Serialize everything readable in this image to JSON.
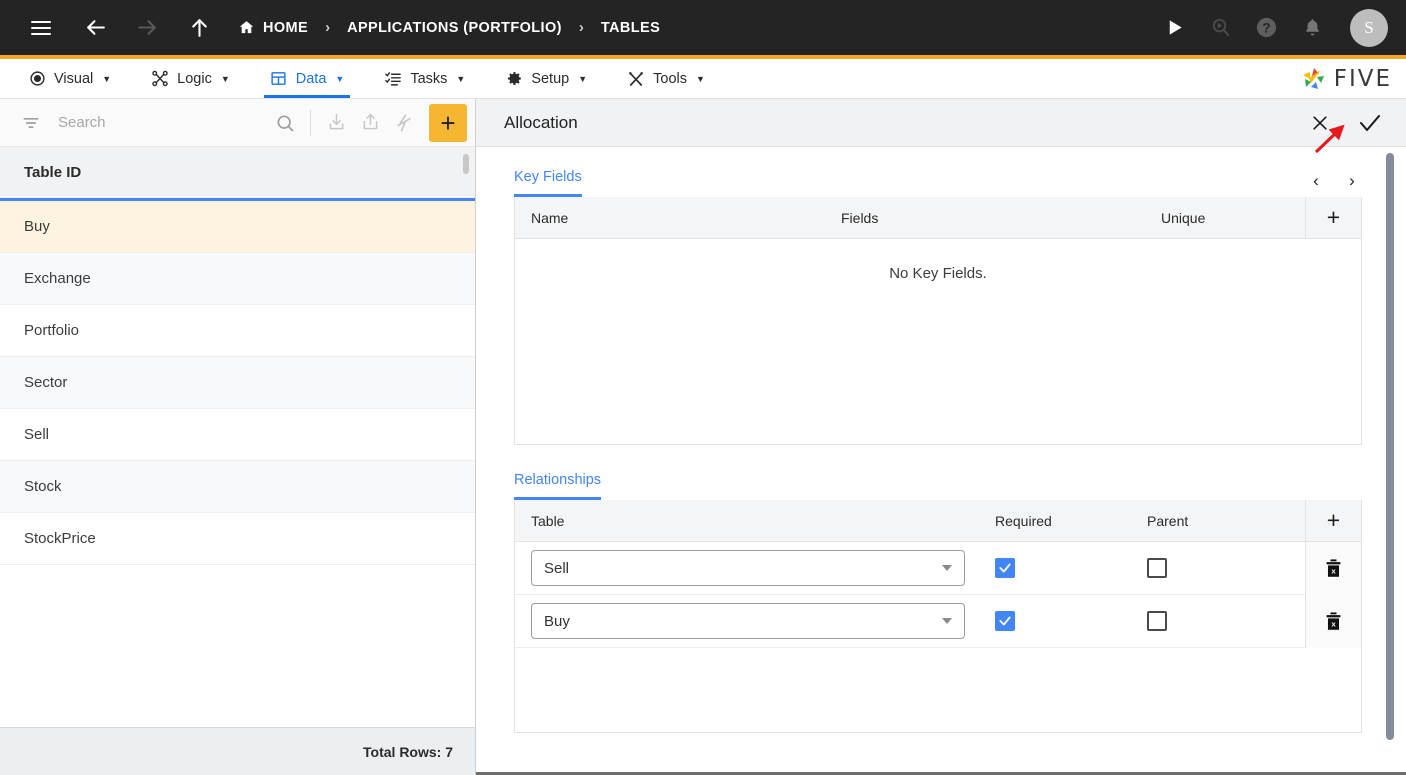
{
  "topbar": {
    "menu_icon": "hamburger-icon",
    "back_icon": "arrow-left-icon",
    "forward_icon": "arrow-right-icon",
    "up_icon": "arrow-up-icon",
    "breadcrumbs": [
      {
        "label": "HOME",
        "icon": "home-icon"
      },
      {
        "label": "APPLICATIONS (PORTFOLIO)",
        "icon": ""
      },
      {
        "label": "TABLES",
        "icon": ""
      }
    ],
    "separator": "›",
    "actions": [
      {
        "name": "run-icon",
        "glyph": "▶"
      },
      {
        "name": "search-run-icon",
        "glyph": ""
      },
      {
        "name": "help-icon",
        "glyph": "?"
      },
      {
        "name": "notifications-bell-icon",
        "glyph": ""
      }
    ],
    "avatar_initial": "S",
    "accent_color": "#F5A623"
  },
  "menubar": {
    "items": [
      {
        "label": "Visual",
        "icon": "eye-icon",
        "active": false
      },
      {
        "label": "Logic",
        "icon": "logic-nodes-icon",
        "active": false
      },
      {
        "label": "Data",
        "icon": "table-grid-icon",
        "active": true
      },
      {
        "label": "Tasks",
        "icon": "tasks-list-icon",
        "active": false
      },
      {
        "label": "Setup",
        "icon": "gear-icon",
        "active": false
      },
      {
        "label": "Tools",
        "icon": "tools-icon",
        "active": false
      }
    ],
    "caret": "▼",
    "active_color": "#1a73e8",
    "brand": "FIVE"
  },
  "left_panel": {
    "search": {
      "placeholder": "Search",
      "value": ""
    },
    "toolbar_icons": [
      {
        "name": "filter-icon"
      },
      {
        "name": "search-icon"
      },
      {
        "name": "import-icon"
      },
      {
        "name": "export-icon"
      },
      {
        "name": "lightning-icon"
      }
    ],
    "add_button_label": "+",
    "add_button_color": "#F5B731",
    "column_header": "Table ID",
    "rows": [
      {
        "label": "Buy",
        "selected": true
      },
      {
        "label": "Exchange",
        "selected": false
      },
      {
        "label": "Portfolio",
        "selected": false
      },
      {
        "label": "Sector",
        "selected": false
      },
      {
        "label": "Sell",
        "selected": false
      },
      {
        "label": "Stock",
        "selected": false
      },
      {
        "label": "StockPrice",
        "selected": false
      }
    ],
    "footer": "Total Rows: 7",
    "selected_row_color": "#FDF3E0"
  },
  "right_panel": {
    "title": "Allocation",
    "close_label": "✕",
    "save_label": "✓",
    "prev_label": "‹",
    "next_label": "›",
    "key_fields": {
      "tab_label": "Key Fields",
      "columns": [
        "Name",
        "Fields",
        "Unique"
      ],
      "add_label": "+",
      "empty_message": "No Key Fields.",
      "rows": []
    },
    "relationships": {
      "tab_label": "Relationships",
      "columns": [
        "Table",
        "Required",
        "Parent"
      ],
      "add_label": "+",
      "rows": [
        {
          "table": "Sell",
          "required": true,
          "parent": false,
          "delete_icon": "trash-icon"
        },
        {
          "table": "Buy",
          "required": true,
          "parent": false,
          "delete_icon": "trash-icon"
        }
      ]
    },
    "checkbox_on_color": "#4285F4",
    "tab_accent_color": "#4285F4"
  },
  "annotation": {
    "type": "red-arrow",
    "color": "#E8191A",
    "points_to": "save-check-button"
  }
}
